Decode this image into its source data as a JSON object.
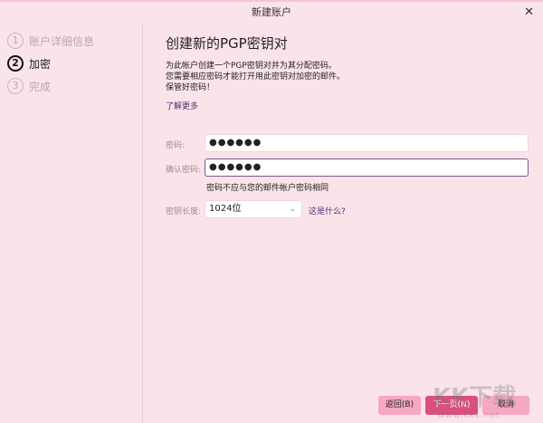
{
  "window": {
    "title": "新建账户",
    "close_icon": "close-icon"
  },
  "steps": [
    {
      "num": "1",
      "label": "账户详细信息",
      "state": "done"
    },
    {
      "num": "2",
      "label": "加密",
      "state": "active"
    },
    {
      "num": "3",
      "label": "完成",
      "state": "pending"
    }
  ],
  "main": {
    "heading": "创建新的PGP密钥对",
    "description": [
      "为此帐户创建一个PGP密钥对并为其分配密码。",
      "您需要相应密码才能打开用此密钥对加密的邮件。",
      "保管好密码！"
    ],
    "learn_more": "了解更多",
    "password_label": "密码:",
    "password_value": "●●●●●●",
    "confirm_label": "确认密码:",
    "confirm_value": "●●●●●●",
    "hint": "密码不应与您的邮件帐户密码相同",
    "key_length_label": "密钥长度:",
    "key_length_value": "1024位",
    "what_is_this": "这是什么?"
  },
  "buttons": {
    "back": "返回(B)",
    "next": "下一页(N)",
    "cancel": "取消"
  },
  "watermark": {
    "logo": "KK下载",
    "url": "www.kkx.net"
  },
  "colors": {
    "background": "#fbe3ea",
    "primary": "#d94f7e",
    "secondary": "#f6a8c1",
    "link": "#5a2a7a"
  }
}
